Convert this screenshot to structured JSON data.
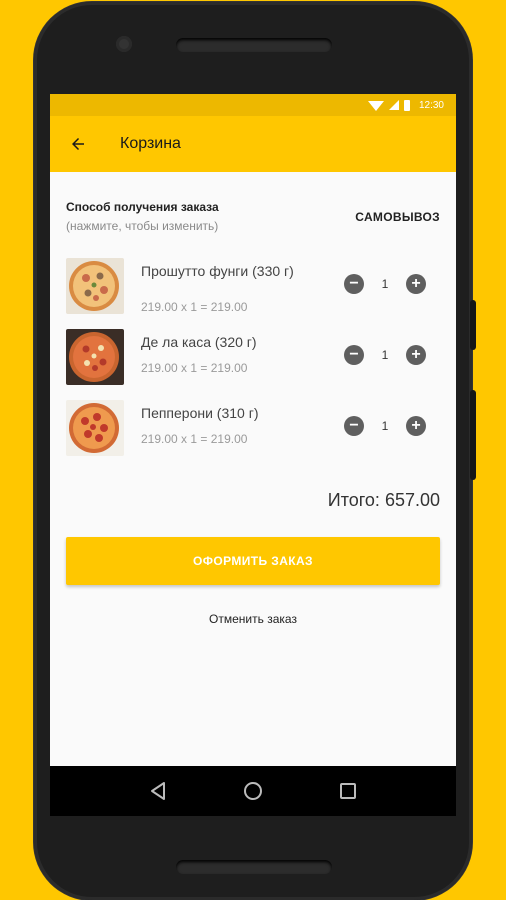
{
  "status_bar": {
    "time": "12:30"
  },
  "app_bar": {
    "title": "Корзина"
  },
  "order_method": {
    "title": "Способ получения заказа",
    "hint": "(нажмите, чтобы изменить)",
    "value": "САМОВЫВОЗ"
  },
  "items": [
    {
      "name": "Прошутто фунги (330 г)",
      "price_line": "219.00 x 1 = 219.00",
      "quantity": "1",
      "image": "pizza-prosciutto-funghi"
    },
    {
      "name": "Де ла каса (320 г)",
      "price_line": "219.00 x 1 = 219.00",
      "quantity": "1",
      "image": "pizza-de-la-casa"
    },
    {
      "name": "Пепперони (310 г)",
      "price_line": "219.00 x 1 = 219.00",
      "quantity": "1",
      "image": "pizza-pepperoni"
    }
  ],
  "total": "Итого: 657.00",
  "checkout_label": "ОФОРМИТЬ ЗАКАЗ",
  "cancel_label": "Отменить заказ",
  "colors": {
    "accent": "#FFC700",
    "status_bar": "#EDB800",
    "stepper": "#5F5F5F"
  },
  "icons": [
    "back-arrow-icon",
    "wifi-icon",
    "signal-icon",
    "battery-icon",
    "minus-icon",
    "plus-icon",
    "nav-back-icon",
    "nav-home-icon",
    "nav-recents-icon"
  ]
}
